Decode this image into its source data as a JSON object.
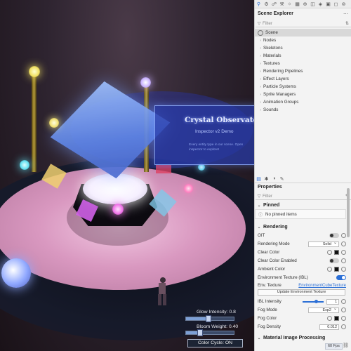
{
  "scene": {
    "panel_title": "Crystal Observatory",
    "panel_subtitle": "Inspector v2 Demo",
    "panel_desc": "Every entity type in our scene. Open inspector to explore!"
  },
  "overlay": {
    "glow_label": "Glow Intensity: 0.8",
    "glow_value": 0.8,
    "bloom_label": "Bloom Weight: 0.40",
    "bloom_value": 0.4,
    "color_cycle_label": "Color Cycle: ON"
  },
  "explorer": {
    "title": "Scene Explorer",
    "filter_placeholder": "Filter",
    "root": "Scene",
    "items": [
      "Nodes",
      "Skeletons",
      "Materials",
      "Textures",
      "Rendering Pipelines",
      "Effect Layers",
      "Particle Systems",
      "Sprite Managers",
      "Animation Groups",
      "Sounds"
    ]
  },
  "properties": {
    "title": "Properties",
    "filter_placeholder": "Filter",
    "pinned_title": "Pinned",
    "pinned_empty": "No pinned items",
    "rendering_title": "Rendering",
    "rows": {
      "oit": "OIT",
      "rendering_mode": "Rendering Mode",
      "rendering_mode_value": "Solid",
      "clear_color": "Clear Color",
      "clear_color_enabled": "Clear Color Enabled",
      "ambient_color": "Ambient Color",
      "env_texture_ibl": "Environment Texture (IBL)",
      "env_texture": "Env. Texture",
      "env_texture_value": "EnvironmentCubeTexture",
      "update_env_button": "Update Environment Texture",
      "ibl_intensity": "IBL Intensity",
      "ibl_intensity_value": "1",
      "fog_mode": "Fog Mode",
      "fog_mode_value": "Exp2",
      "fog_color": "Fog Color",
      "fog_density": "Fog Density",
      "fog_density_value": "0.012"
    },
    "material_section": "Material Image Processing",
    "fps": "60 Fps"
  },
  "colors": {
    "accent": "#2b6fd6",
    "clear_color": "#111111",
    "ambient_color": "#111111",
    "fog_color": "#111111"
  }
}
